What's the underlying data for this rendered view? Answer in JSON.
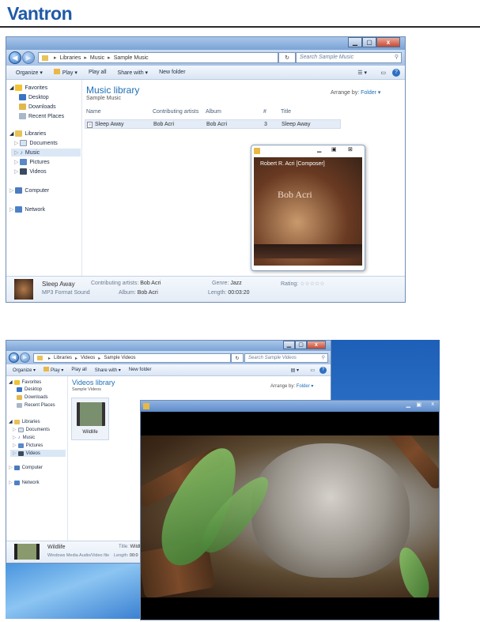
{
  "brand": "Vantron",
  "music": {
    "breadcrumb": [
      "Libraries",
      "Music",
      "Sample Music"
    ],
    "search_placeholder": "Search Sample Music",
    "commands": [
      "Organize ▾",
      "Play ▾",
      "Play all",
      "Share with ▾",
      "New folder"
    ],
    "nav": {
      "favorites": "Favorites",
      "desktop": "Desktop",
      "downloads": "Downloads",
      "recent": "Recent Places",
      "libraries": "Libraries",
      "documents": "Documents",
      "music": "Music",
      "pictures": "Pictures",
      "videos": "Videos",
      "computer": "Computer",
      "network": "Network"
    },
    "library_title": "Music library",
    "library_sub": "Sample Music",
    "arrange_label": "Arrange by:",
    "arrange_value": "Folder ▾",
    "columns": [
      "Name",
      "Contributing artists",
      "Album",
      "#",
      "Title"
    ],
    "rows": [
      {
        "name": "Sleep Away",
        "artist": "Bob Acri",
        "album": "Bob Acri",
        "num": "3",
        "title": "Sleep Away"
      }
    ],
    "player": {
      "cover_top": "Robert R. Acri [Composer]",
      "cover_name": "Bob Acri"
    },
    "details": {
      "name": "Sleep Away",
      "type": "MP3 Format Sound",
      "artists_label": "Contributing artists:",
      "artists_value": "Bob Acri",
      "album_label": "Album:",
      "album_value": "Bob Acri",
      "genre_label": "Genre:",
      "genre_value": "Jazz",
      "length_label": "Length:",
      "length_value": "00:03:20",
      "rating_label": "Rating:",
      "rating_value": "☆☆☆☆☆"
    }
  },
  "video": {
    "breadcrumb": [
      "Libraries",
      "Videos",
      "Sample Videos"
    ],
    "search_placeholder": "Search Sample Videos",
    "commands": [
      "Organize ▾",
      "Play ▾",
      "Play all",
      "Share with ▾",
      "New folder"
    ],
    "nav": {
      "favorites": "Favorites",
      "desktop": "Desktop",
      "downloads": "Downloads",
      "recent": "Recent Places",
      "libraries": "Libraries",
      "documents": "Documents",
      "music": "Music",
      "pictures": "Pictures",
      "videos": "Videos",
      "computer": "Computer",
      "network": "Network"
    },
    "library_title": "Videos library",
    "library_sub": "Sample Videos",
    "arrange_label": "Arrange by:",
    "arrange_value": "Folder ▾",
    "file": "Wildlife",
    "details": {
      "name": "Wildlife",
      "type": "Windows Media Audio/Video file",
      "title_label": "Title:",
      "title_value": "Wildl",
      "length_label": "Length:",
      "length_value": "00:0"
    }
  },
  "colors": {
    "brand": "#1f5aa8",
    "accent": "#1e6fb6",
    "desktop": "#2f77cf"
  }
}
